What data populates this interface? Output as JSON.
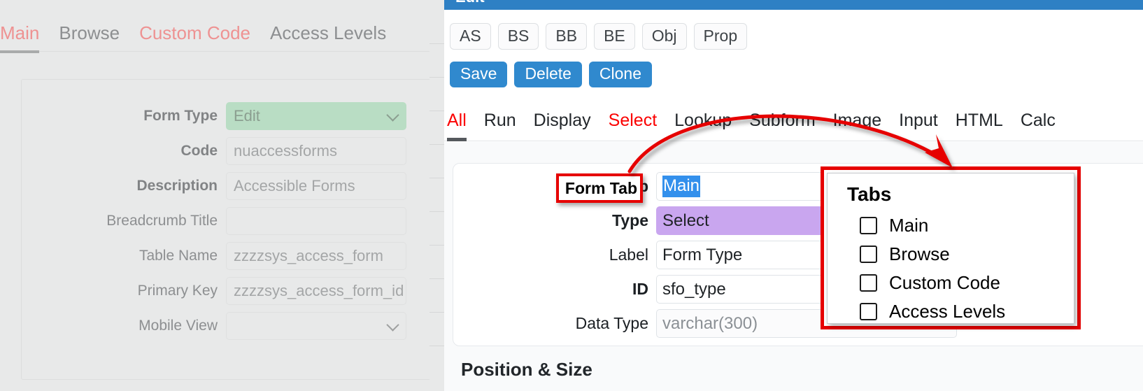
{
  "left_panel": {
    "tabs": [
      {
        "label": "Main",
        "state": "active-red"
      },
      {
        "label": "Browse",
        "state": "normal"
      },
      {
        "label": "Custom Code",
        "state": "red"
      },
      {
        "label": "Access Levels",
        "state": "normal"
      }
    ],
    "fields": [
      {
        "label": "Form Type",
        "value": "Edit",
        "type": "select",
        "style": "green",
        "bold": true
      },
      {
        "label": "Code",
        "value": "nuaccessforms",
        "type": "text",
        "style": "plain",
        "bold": true
      },
      {
        "label": "Description",
        "value": "Accessible Forms",
        "type": "text",
        "style": "plain",
        "bold": true
      },
      {
        "label": "Breadcrumb Title",
        "value": "",
        "type": "text",
        "style": "plain",
        "bold": false
      },
      {
        "label": "Table Name",
        "value": "zzzzsys_access_form",
        "type": "text",
        "style": "plain",
        "bold": false
      },
      {
        "label": "Primary Key",
        "value": "zzzzsys_access_form_id",
        "type": "text",
        "style": "plain",
        "bold": false
      },
      {
        "label": "Mobile View",
        "value": "",
        "type": "select",
        "style": "plain",
        "bold": false
      }
    ]
  },
  "right_panel": {
    "title": "Edit",
    "small_buttons": [
      "AS",
      "BS",
      "BB",
      "BE",
      "Obj",
      "Prop"
    ],
    "action_buttons": [
      "Save",
      "Delete",
      "Clone"
    ],
    "nav_tabs": [
      {
        "label": "All",
        "state": "active-red"
      },
      {
        "label": "Run",
        "state": "normal"
      },
      {
        "label": "Display",
        "state": "normal"
      },
      {
        "label": "Select",
        "state": "red"
      },
      {
        "label": "Lookup",
        "state": "normal"
      },
      {
        "label": "Subform",
        "state": "normal"
      },
      {
        "label": "Image",
        "state": "normal"
      },
      {
        "label": "Input",
        "state": "normal"
      },
      {
        "label": "HTML",
        "state": "normal"
      },
      {
        "label": "Calc",
        "state": "normal"
      }
    ],
    "fields": [
      {
        "label": "Form Tab",
        "value": "Main",
        "type": "text",
        "style": "selected",
        "bold": true
      },
      {
        "label": "Type",
        "value": "Select",
        "type": "select",
        "style": "purple",
        "bold": true
      },
      {
        "label": "Label",
        "value": "Form Type",
        "type": "text",
        "style": "plain",
        "bold": false
      },
      {
        "label": "ID",
        "value": "sfo_type",
        "type": "text",
        "style": "plain",
        "bold": true
      },
      {
        "label": "Data Type",
        "value": "varchar(300)",
        "type": "text",
        "style": "muted",
        "bold": false
      }
    ],
    "section_title": "Position & Size"
  },
  "annotations": {
    "highlight_label": "Form Tab",
    "popup": {
      "title": "Tabs",
      "options": [
        {
          "label": "Main",
          "checked": false
        },
        {
          "label": "Browse",
          "checked": false
        },
        {
          "label": "Custom Code",
          "checked": false
        },
        {
          "label": "Access Levels",
          "checked": false
        }
      ]
    },
    "arrow_color": "#e60000",
    "box_color": "#e60000"
  }
}
